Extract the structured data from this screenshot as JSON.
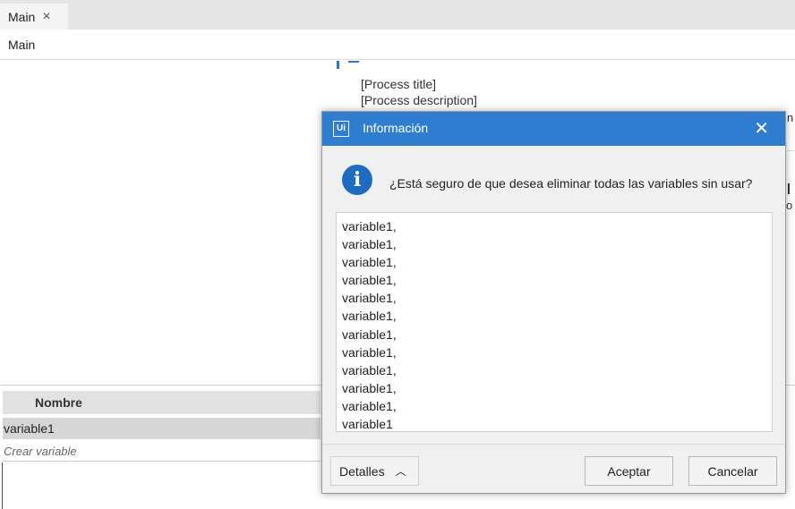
{
  "tab": {
    "label": "Main",
    "close_icon": "×"
  },
  "breadcrumb": "Main",
  "canvas": {
    "process_title": "[Process title]",
    "process_description": "[Process description]",
    "edge_text_1": "n",
    "edge_text_2": "o"
  },
  "variables_panel": {
    "column_header": "Nombre",
    "rows": [
      "variable1"
    ],
    "create_placeholder": "Crear variable"
  },
  "dialog": {
    "logo_text": "Ui",
    "title": "Información",
    "close_icon": "✕",
    "info_icon": "i",
    "question": "¿Está seguro de que desea eliminar todas las variables sin usar?",
    "variables": [
      "variable1,",
      "variable1,",
      "variable1,",
      "variable1,",
      "variable1,",
      "variable1,",
      "variable1,",
      "variable1,",
      "variable1,",
      "variable1,",
      "variable1,",
      "variable1"
    ],
    "details_button": "Detalles",
    "details_chevron": "︿",
    "ok_button": "Aceptar",
    "cancel_button": "Cancelar",
    "accent_color": "#2e7dd1"
  }
}
